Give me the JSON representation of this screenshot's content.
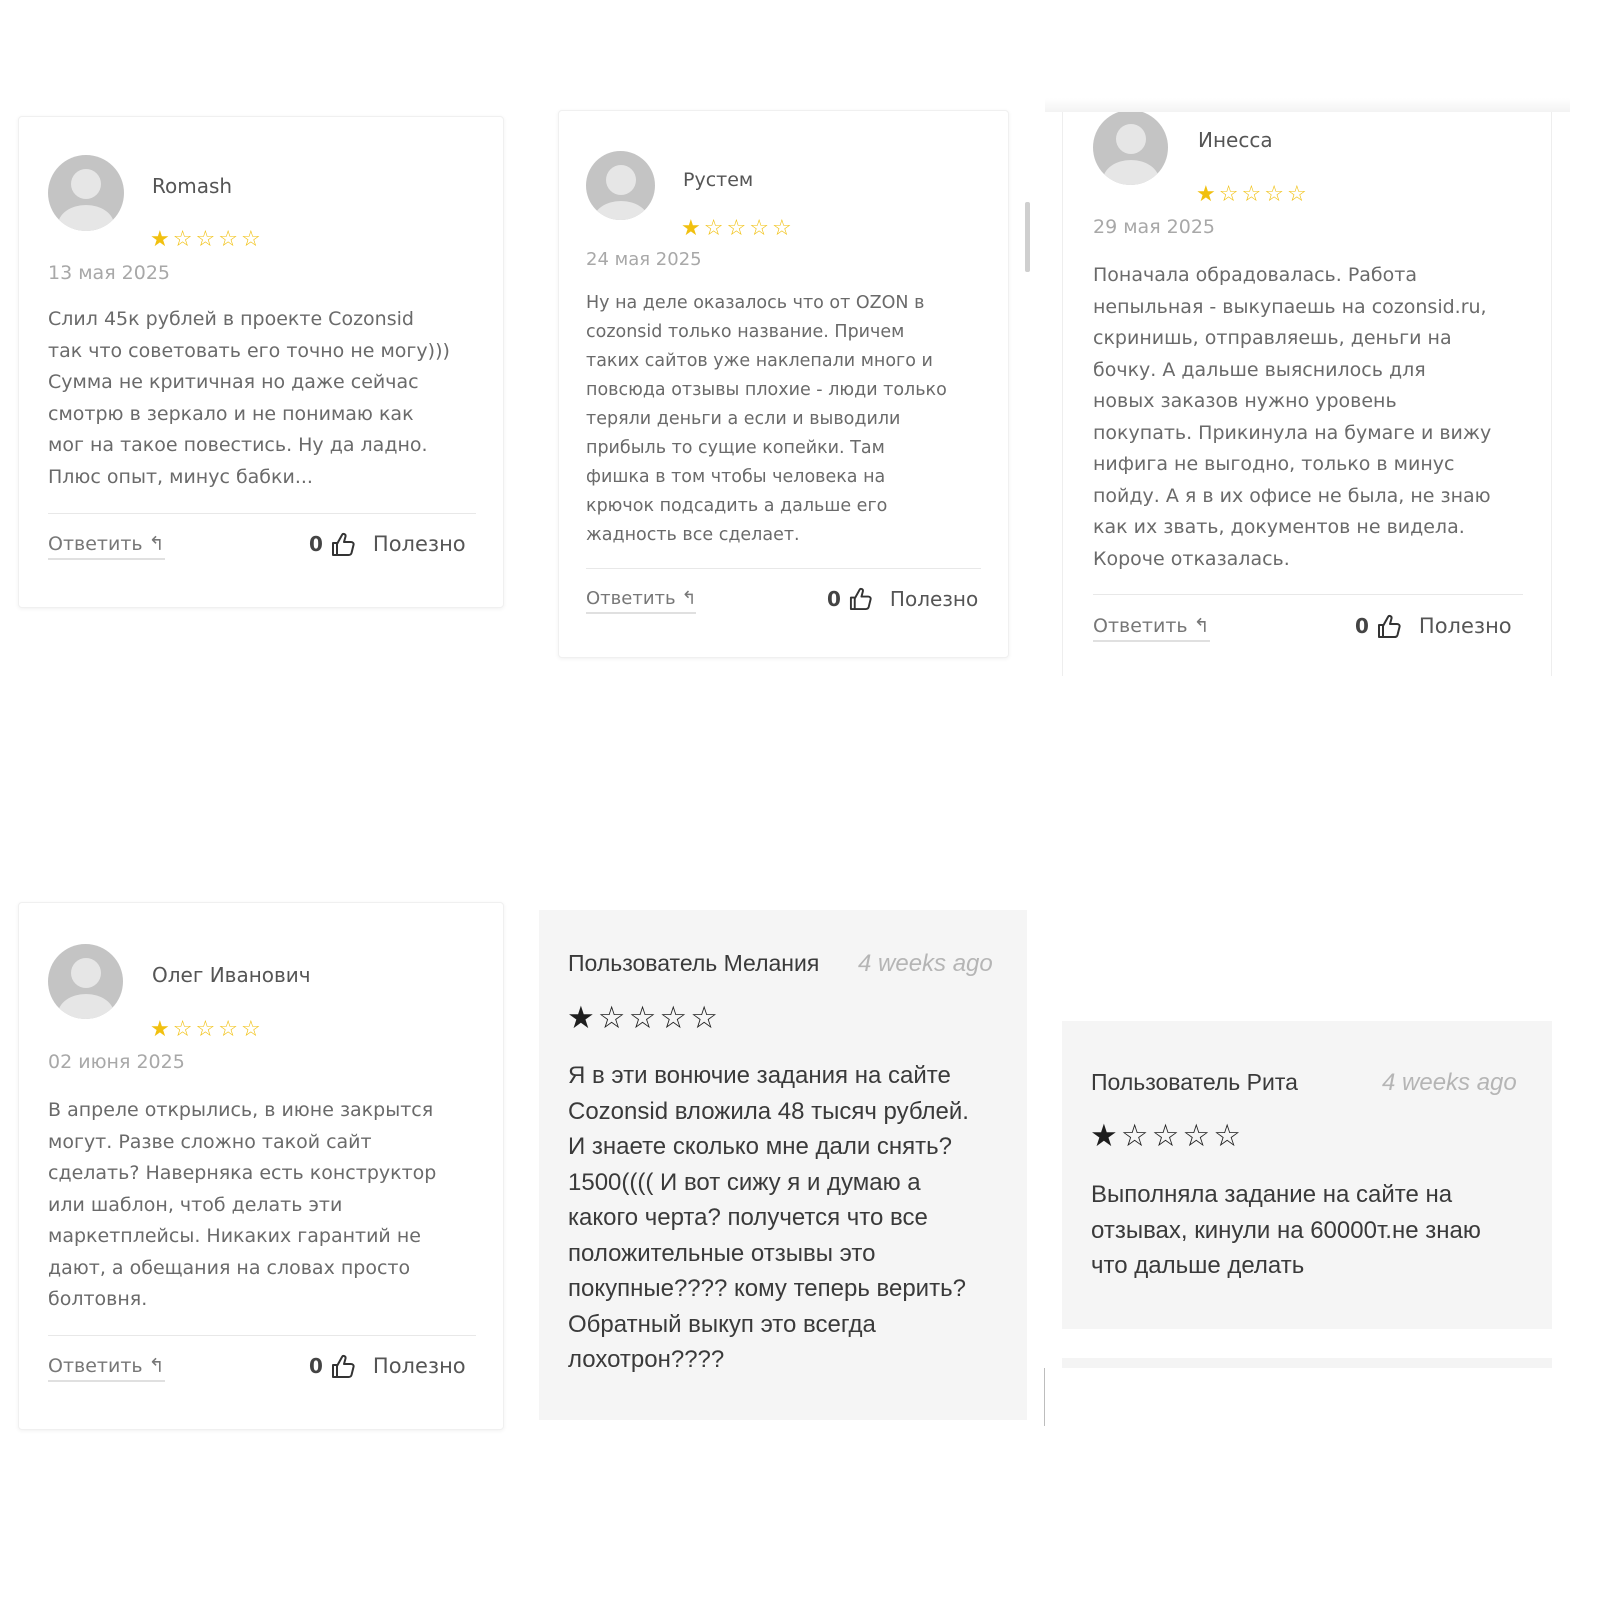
{
  "reviews": [
    {
      "name": "Romash",
      "rating": 1,
      "max_rating": 5,
      "date": "13 мая 2025",
      "text": "Слил 45к рублей в проекте Cozonsid\nтак что советовать его точно не могу)))\nСумма не критичная но даже сейчас\nсмотрю в зеркало и не понимаю как\nмог на такое повестись. Ну да ладно.\nПлюс опыт, минус бабки...",
      "reply_label": "Ответить ↰",
      "votes": "0",
      "useful_label": "Полезно"
    },
    {
      "name": "Рустем",
      "rating": 1,
      "max_rating": 5,
      "date": "24 мая 2025",
      "text": "Ну на деле оказалось что от OZON в\ncozonsid только название. Причем\nтаких сайтов уже наклепали много и\nповсюда отзывы плохие - люди только\nтеряли деньги а если и выводили\nприбыль то сущие копейки. Там\nфишка в том чтобы человека на\nкрючок подсадить а дальше его\nжадность все сделает.",
      "reply_label": "Ответить ↰",
      "votes": "0",
      "useful_label": "Полезно"
    },
    {
      "name": "Инесса",
      "rating": 1,
      "max_rating": 5,
      "date": "29 мая 2025",
      "text": "Поначала обрадовалась. Работа\nнепыльная - выкупаешь на cozonsid.ru,\nскринишь, отправляешь, деньги на\nбочку. А дальше выяснилось для\nновых заказов нужно уровень\nпокупать. Прикинула на бумаге и вижу\nнифига не выгодно, только в минус\nпойду. А я в их офисе не была, не знаю\nкак их звать, документов не видела.\nКороче отказалась.",
      "reply_label": "Ответить ↰",
      "votes": "0",
      "useful_label": "Полезно"
    },
    {
      "name": "Олег Иванович",
      "rating": 1,
      "max_rating": 5,
      "date": "02 июня 2025",
      "text": "В апреле открылись, в июне закрытся\nмогут. Разве сложно такой сайт\nсделать? Наверняка есть конструктор\nили шаблон, чтоб делать эти\nмаркетплейсы. Никаких гарантий не\nдают, а обещания на словах просто\nболтовня.",
      "reply_label": "Ответить ↰",
      "votes": "0",
      "useful_label": "Полезно"
    }
  ],
  "user_reviews": [
    {
      "user": "Пользователь Мелания",
      "time_ago": "4 weeks ago",
      "rating": 1,
      "max_rating": 5,
      "text": "Я в эти вонючие задания на сайте\nCozonsid вложила 48 тысяч рублей.\nИ знаете сколько мне дали снять?\n1500(((( И вот сижу я и думаю а\nкакого черта? получется что все\nположительные отзывы это\nпокупные???? кому теперь верить?\nОбратный выкуп это всегда\nлохотрон????"
    },
    {
      "user": "Пользователь Рита",
      "time_ago": "4 weeks ago",
      "rating": 1,
      "max_rating": 5,
      "text": "Выполняла задание на сайте на\nотзывах, кинули на 60000т.не знаю\nчто дальше делать"
    }
  ],
  "colors": {
    "star_gold": "#f1c00f",
    "star_dark": "#1e1e1e",
    "card_gray": "#f5f5f5"
  },
  "icons": {
    "thumb": "thumbs-up-icon",
    "star_filled": "star-filled-icon",
    "star_empty": "star-empty-icon",
    "avatar": "avatar-placeholder"
  }
}
